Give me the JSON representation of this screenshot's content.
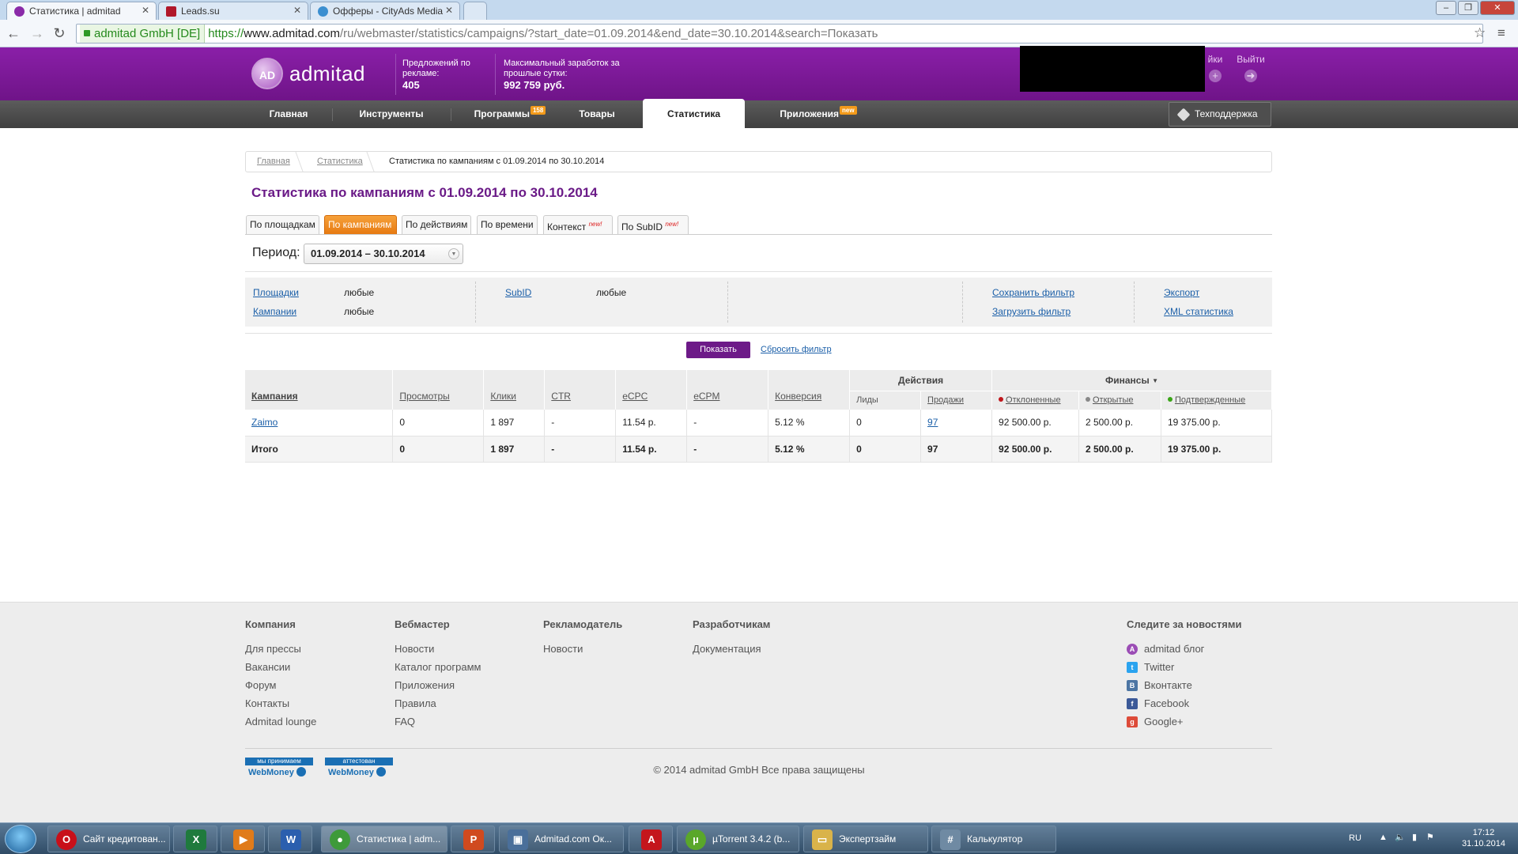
{
  "browser": {
    "tabs": [
      {
        "label": "Статистика | admitad",
        "active": true,
        "icon": "admitad-favicon-icon"
      },
      {
        "label": "Leads.su",
        "active": false,
        "icon": "leads-favicon-icon"
      },
      {
        "label": "Офферы - CityAds Media",
        "active": false,
        "icon": "cityads-favicon-icon"
      }
    ],
    "secure_label": "admitad GmbH [DE]",
    "url_scheme": "https://",
    "url_host": "www.admitad.com",
    "url_path": "/ru/webmaster/statistics/campaigns/?start_date=01.09.2014&end_date=30.10.2014&search=Показать"
  },
  "header": {
    "logo_mark": "AD",
    "logo_text": "admitad",
    "offers_label": "Предложений по рекламе:",
    "offers_value": "405",
    "max_earn_label": "Максимальный заработок за прошлые сутки:",
    "max_earn_value": "992 759 руб.",
    "settings_label": "йки",
    "logout_label": "Выйти"
  },
  "nav": {
    "items": [
      {
        "label": "Главная"
      },
      {
        "label": "Инструменты"
      },
      {
        "label": "Программы",
        "badge": "158"
      },
      {
        "label": "Товары"
      },
      {
        "label": "Статистика",
        "active": true
      },
      {
        "label": "Приложения",
        "badge": "new"
      }
    ],
    "support_label": "Техподдержка"
  },
  "breadcrumb": {
    "home": "Главная",
    "section": "Статистика",
    "current": "Статистика по кампаниям с 01.09.2014 по 30.10.2014"
  },
  "page_title": "Статистика по кампаниям с 01.09.2014 по 30.10.2014",
  "report_tabs": [
    {
      "label": "По площадкам",
      "active": false,
      "new": ""
    },
    {
      "label": "По кампаниям",
      "active": true,
      "new": ""
    },
    {
      "label": "По действиям",
      "active": false,
      "new": ""
    },
    {
      "label": "По времени",
      "active": false,
      "new": ""
    },
    {
      "label": "Контекст",
      "active": false,
      "new": "new!"
    },
    {
      "label": "По SubID",
      "active": false,
      "new": "new!"
    }
  ],
  "period": {
    "label": "Период:",
    "value": "01.09.2014 – 30.10.2014"
  },
  "filters": {
    "sites_label": "Площадки",
    "sites_value": "любые",
    "campaigns_label": "Кампании",
    "campaigns_value": "любые",
    "subid_label": "SubID",
    "subid_value": "любые",
    "save_filter": "Сохранить фильтр",
    "load_filter": "Загрузить фильтр",
    "export": "Экспорт",
    "xml_stats": "XML статистика",
    "show_button": "Показать",
    "reset_filter": "Сбросить фильтр"
  },
  "table": {
    "headers": {
      "campaign": "Кампания",
      "views": "Просмотры",
      "clicks": "Клики",
      "ctr": "CTR",
      "ecpc": "eCPC",
      "ecpm": "eCPM",
      "conversion": "Конверсия",
      "actions": "Действия",
      "finance": "Финансы",
      "leads": "Лиды",
      "sales": "Продажи",
      "declined": "Отклоненные",
      "open": "Открытые",
      "approved": "Подтвержденные"
    },
    "status_colors": {
      "declined": "#c0161c",
      "open": "#888888",
      "approved": "#3aa517"
    },
    "rows": [
      {
        "campaign": "Zaimo",
        "views": "0",
        "clicks": "1 897",
        "ctr": "-",
        "ecpc": "11.54 р.",
        "ecpm": "-",
        "conversion": "5.12 %",
        "leads": "0",
        "sales": "97",
        "declined": "92 500.00 р.",
        "open": "2 500.00 р.",
        "approved": "19 375.00 р."
      }
    ],
    "total": {
      "campaign": "Итого",
      "views": "0",
      "clicks": "1 897",
      "ctr": "-",
      "ecpc": "11.54 р.",
      "ecpm": "-",
      "conversion": "5.12 %",
      "leads": "0",
      "sales": "97",
      "declined": "92 500.00 р.",
      "open": "2 500.00 р.",
      "approved": "19 375.00 р."
    }
  },
  "footer": {
    "columns": [
      {
        "title": "Компания",
        "items": [
          "Для прессы",
          "Вакансии",
          "Форум",
          "Контакты",
          "Admitad lounge"
        ]
      },
      {
        "title": "Вебмастер",
        "items": [
          "Новости",
          "Каталог программ",
          "Приложения",
          "Правила",
          "FAQ"
        ]
      },
      {
        "title": "Рекламодатель",
        "items": [
          "Новости"
        ]
      },
      {
        "title": "Разработчикам",
        "items": [
          "Документация"
        ]
      }
    ],
    "social_title": "Следите за новостями",
    "social": [
      {
        "label": "admitad блог",
        "icon": "admitad-blog-icon",
        "color": "#9b4db5"
      },
      {
        "label": "Twitter",
        "icon": "twitter-icon",
        "color": "#2aa3ef"
      },
      {
        "label": "Вконтакте",
        "icon": "vkontakte-icon",
        "color": "#4c75a3"
      },
      {
        "label": "Facebook",
        "icon": "facebook-icon",
        "color": "#3b5998"
      },
      {
        "label": "Google+",
        "icon": "googleplus-icon",
        "color": "#dd4b39"
      }
    ],
    "webmoney_accept_top": "мы принимаем",
    "webmoney_attest_top": "аттестован",
    "webmoney_label": "WebMoney",
    "copyright": "© 2014 admitad GmbH Все права защищены"
  },
  "taskbar": {
    "items": [
      {
        "label": "Сайт кредитован...",
        "icon": "opera-icon",
        "color": "#c8101a"
      },
      {
        "label": "",
        "icon": "excel-icon",
        "color": "#1f7a3d"
      },
      {
        "label": "",
        "icon": "media-player-icon",
        "color": "#e07b1a"
      },
      {
        "label": "",
        "icon": "word-icon",
        "color": "#2b5fae"
      },
      {
        "label": "Статистика | adm...",
        "icon": "chrome-icon",
        "color": "#3e9a3a",
        "active": true
      },
      {
        "label": "",
        "icon": "powerpoint-icon",
        "color": "#d04a1f"
      },
      {
        "label": "Admitad.com Ок...",
        "icon": "window-icon",
        "color": "#4a6f9a"
      },
      {
        "label": "",
        "icon": "acrobat-icon",
        "color": "#c4161c"
      },
      {
        "label": "µTorrent 3.4.2 (b...",
        "icon": "utorrent-icon",
        "color": "#5aa72a"
      },
      {
        "label": "Экспертзайм",
        "icon": "folder-icon",
        "color": "#d9b34a"
      },
      {
        "label": "Калькулятор",
        "icon": "calculator-icon",
        "color": "#6f8aa3"
      }
    ],
    "lang": "RU",
    "time": "17:12",
    "date": "31.10.2014"
  }
}
